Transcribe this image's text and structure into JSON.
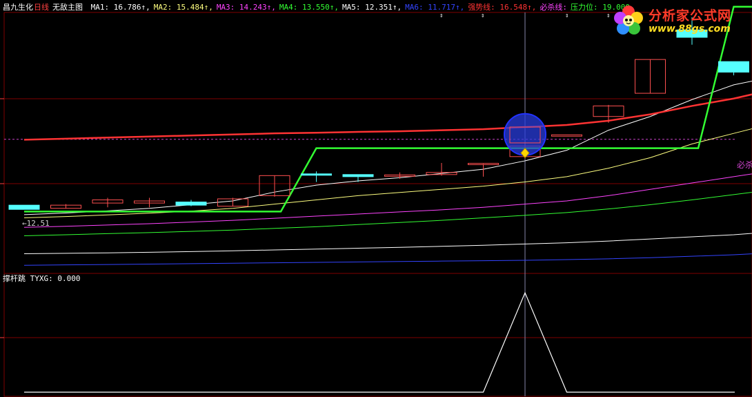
{
  "header": {
    "stock_name": "昌九生化",
    "period": "日线",
    "indicator_name": "无敌主图",
    "ma_items": [
      {
        "label": "MA1: 16.786↑,",
        "color": "#ffffff"
      },
      {
        "label": "MA2: 15.484↑,",
        "color": "#ffff80"
      },
      {
        "label": "MA3: 14.243↑,",
        "color": "#ff44ff"
      },
      {
        "label": "MA4: 13.550↑,",
        "color": "#33ff33"
      },
      {
        "label": "MA5: 12.351↑,",
        "color": "#ffffff"
      },
      {
        "label": "MA6: 11.717↑,",
        "color": "#3344ff"
      },
      {
        "label": "强势线: 16.548↑,",
        "color": "#ff3333"
      },
      {
        "label": "必杀线:",
        "color": "#ff44ff"
      },
      {
        "label": "压力位: 19.000,",
        "color": "#33ff33"
      }
    ]
  },
  "sub_panel": {
    "label": "撑杆跳 TYXG: 0.000"
  },
  "price_label": "←12.51",
  "bisha_label": "必杀",
  "logo": {
    "title": "分析家公式网",
    "url": "www.88gs.com"
  },
  "colors": {
    "background": "#000000",
    "grid": "#800000",
    "up": "#ff5050",
    "down": "#55ffff"
  },
  "chart_data": {
    "type": "candlestick",
    "candles": [
      {
        "open": 12.6,
        "close": 12.4,
        "high": 12.6,
        "low": 12.4
      },
      {
        "open": 12.45,
        "close": 12.6,
        "high": 12.65,
        "low": 12.45
      },
      {
        "open": 12.7,
        "close": 12.85,
        "high": 12.95,
        "low": 12.5
      },
      {
        "open": 12.7,
        "close": 12.8,
        "high": 12.95,
        "low": 12.5
      },
      {
        "open": 12.75,
        "close": 12.6,
        "high": 12.85,
        "low": 12.55
      },
      {
        "open": 12.55,
        "close": 12.9,
        "high": 12.95,
        "low": 12.55
      },
      {
        "open": 13.05,
        "close": 14.0,
        "high": 14.0,
        "low": 13.0
      },
      {
        "open": 14.05,
        "close": 14.0,
        "high": 14.2,
        "low": 13.7
      },
      {
        "open": 14.05,
        "close": 13.95,
        "high": 14.05,
        "low": 13.7
      },
      {
        "open": 14.0,
        "close": 14.0,
        "high": 14.15,
        "low": 13.85
      },
      {
        "open": 14.05,
        "close": 14.15,
        "high": 14.6,
        "low": 14.0
      },
      {
        "open": 14.55,
        "close": 14.55,
        "high": 14.55,
        "low": 13.95
      },
      {
        "open": 14.9,
        "close": 15.4,
        "high": 15.4,
        "low": 14.8
      },
      {
        "open": 15.9,
        "close": 15.9,
        "high": 15.9,
        "low": 15.9
      },
      {
        "open": 16.8,
        "close": 17.3,
        "high": 17.35,
        "low": 16.5
      },
      {
        "open": 17.9,
        "close": 19.5,
        "high": 19.5,
        "low": 17.9
      },
      {
        "open": 20.9,
        "close": 20.55,
        "high": 21.5,
        "low": 20.2
      },
      {
        "open": 19.4,
        "close": 18.9,
        "high": 19.4,
        "low": 18.75
      },
      {
        "open": 18.35,
        "close": 18.95,
        "high": 19.05,
        "low": 17.95
      }
    ],
    "ma_series": [
      {
        "name": "MA1",
        "color": "#ffffff",
        "values": [
          12.15,
          12.23,
          12.33,
          12.45,
          12.62,
          12.8,
          13.22,
          13.55,
          13.75,
          13.9,
          14.1,
          14.3,
          14.7,
          15.2,
          16.15,
          16.8,
          17.6,
          18.3,
          18.7
        ]
      },
      {
        "name": "MA2",
        "color": "#ffff80",
        "values": [
          12.0,
          12.06,
          12.14,
          12.22,
          12.32,
          12.45,
          12.65,
          12.85,
          13.05,
          13.2,
          13.35,
          13.5,
          13.7,
          13.95,
          14.35,
          14.85,
          15.5,
          16.0,
          16.5
        ]
      },
      {
        "name": "MA3",
        "color": "#ff44ff",
        "values": [
          11.55,
          11.6,
          11.66,
          11.72,
          11.8,
          11.88,
          11.98,
          12.08,
          12.18,
          12.28,
          12.38,
          12.5,
          12.65,
          12.8,
          13.05,
          13.35,
          13.65,
          13.95,
          14.25
        ]
      },
      {
        "name": "MA4",
        "color": "#33ff33",
        "values": [
          11.15,
          11.2,
          11.25,
          11.3,
          11.36,
          11.42,
          11.5,
          11.58,
          11.68,
          11.78,
          11.88,
          12.0,
          12.12,
          12.25,
          12.42,
          12.62,
          12.85,
          13.1,
          13.35
        ]
      },
      {
        "name": "MA5",
        "color": "#ffffff",
        "values": [
          10.3,
          10.32,
          10.34,
          10.37,
          10.4,
          10.44,
          10.48,
          10.52,
          10.56,
          10.6,
          10.65,
          10.7,
          10.76,
          10.82,
          10.9,
          11.0,
          11.1,
          11.2,
          11.35
        ]
      },
      {
        "name": "MA6",
        "color": "#3344ff",
        "values": [
          9.75,
          9.77,
          9.79,
          9.81,
          9.83,
          9.85,
          9.87,
          9.89,
          9.91,
          9.93,
          9.95,
          9.97,
          9.99,
          10.02,
          10.06,
          10.11,
          10.18,
          10.25,
          10.35
        ]
      },
      {
        "name": "强势线",
        "color": "#ff3333",
        "values": [
          15.7,
          15.75,
          15.8,
          15.85,
          15.9,
          15.95,
          16.0,
          16.03,
          16.07,
          16.1,
          16.15,
          16.2,
          16.3,
          16.4,
          16.6,
          16.9,
          17.3,
          17.65,
          18.1
        ]
      },
      {
        "name": "压力位",
        "color": "#33ff33",
        "values": [
          12.3,
          12.3,
          12.3,
          12.3,
          12.3,
          12.3,
          12.3,
          15.3,
          15.3,
          15.3,
          15.3,
          15.3,
          15.3,
          15.3,
          15.3,
          15.3,
          15.3,
          22.0,
          22.0
        ]
      }
    ],
    "bisha_level": 15.72,
    "tyxg": [
      0,
      0,
      0,
      0,
      0,
      0,
      0,
      0,
      0,
      0,
      0,
      0,
      0,
      0,
      0,
      0,
      0,
      0,
      0,
      0,
      0,
      0,
      0,
      0,
      0,
      0,
      0,
      0,
      0,
      0,
      0,
      0,
      0,
      0,
      0,
      0,
      0,
      0,
      0,
      0,
      0,
      0,
      0,
      0,
      0,
      0,
      0,
      0,
      0,
      0,
      0,
      0,
      0,
      0,
      0,
      0,
      0,
      0,
      0,
      0,
      0,
      0,
      0,
      0,
      0,
      0,
      0,
      0,
      0,
      0,
      0,
      0,
      0,
      0,
      0,
      0,
      0,
      0,
      0,
      0,
      0,
      0,
      0,
      0,
      0,
      0,
      0,
      0,
      0,
      0,
      0,
      0,
      0,
      0,
      0,
      0,
      0,
      0,
      0,
      0,
      0,
      0,
      0,
      0,
      0,
      0,
      0,
      0,
      0,
      0,
      0,
      0,
      0,
      0,
      0,
      0,
      0,
      0,
      0,
      0,
      0,
      0,
      0,
      0,
      0,
      0,
      0,
      0,
      0,
      0
    ],
    "tyxg_peak_index": 12,
    "tyxg_max": 1,
    "selected_index": 12,
    "y_range": [
      9.4,
      21.5
    ]
  }
}
